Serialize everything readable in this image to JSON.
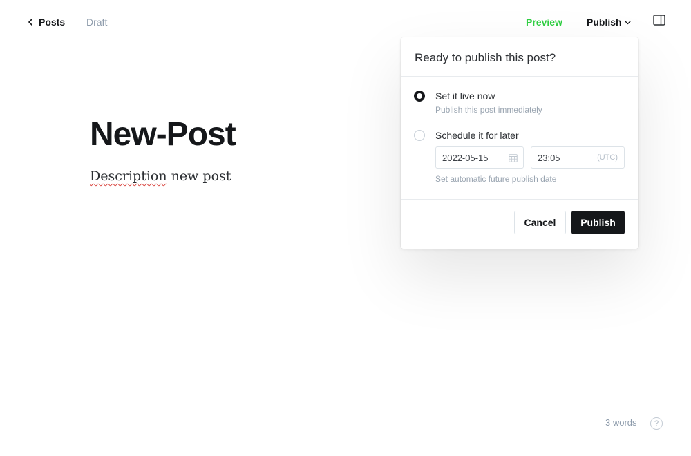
{
  "topbar": {
    "back_label": "Posts",
    "status": "Draft",
    "preview_label": "Preview",
    "publish_label": "Publish"
  },
  "editor": {
    "title": "New-Post",
    "body_misspelled": "Description",
    "body_rest": " new post"
  },
  "footer": {
    "word_count": "3 words",
    "help": "?"
  },
  "publish_popover": {
    "title": "Ready to publish this post?",
    "options": [
      {
        "label": "Set it live now",
        "description": "Publish this post immediately",
        "selected": true
      },
      {
        "label": "Schedule it for later",
        "description": "Set automatic future publish date",
        "selected": false
      }
    ],
    "date_value": "2022-05-15",
    "time_value": "23:05",
    "timezone": "(UTC)",
    "cancel_label": "Cancel",
    "confirm_label": "Publish"
  },
  "colors": {
    "accent_green": "#30cf43",
    "primary_dark": "#15171a",
    "muted_text": "#8e9cac",
    "spellcheck_red": "#d8433d"
  },
  "icons": {
    "back": "chevron-left-icon",
    "publish_menu": "chevron-down-icon",
    "sidebar": "sidebar-panel-icon",
    "calendar": "calendar-icon",
    "help": "question-circle-icon"
  }
}
